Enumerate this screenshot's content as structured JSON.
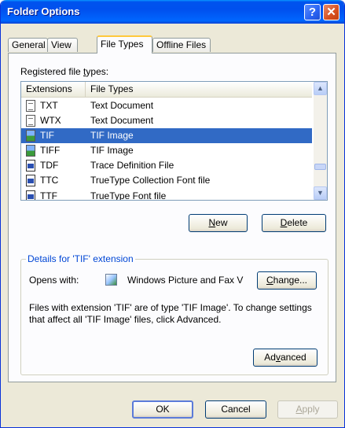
{
  "window": {
    "title": "Folder Options",
    "help_glyph": "?",
    "close_glyph": "✕"
  },
  "tabs": [
    {
      "label": "General",
      "active": false
    },
    {
      "label": "View",
      "active": false
    },
    {
      "label": "File Types",
      "active": true
    },
    {
      "label": "Offline Files",
      "active": false
    }
  ],
  "registered": {
    "label_pre": "Registered file ",
    "label_key": "t",
    "label_post": "ypes:"
  },
  "list": {
    "columns": [
      "Extensions",
      "File Types"
    ],
    "rows": [
      {
        "ext": "TXT",
        "type": "Text Document",
        "icon": "text-document-icon",
        "selected": false
      },
      {
        "ext": "WTX",
        "type": "Text Document",
        "icon": "text-document-icon",
        "selected": false
      },
      {
        "ext": "TIF",
        "type": "TIF Image",
        "icon": "image-file-icon",
        "selected": true
      },
      {
        "ext": "TIFF",
        "type": "TIF Image",
        "icon": "image-file-icon",
        "selected": false
      },
      {
        "ext": "TDF",
        "type": "Trace Definition File",
        "icon": "font-file-icon",
        "selected": false
      },
      {
        "ext": "TTC",
        "type": "TrueType Collection Font file",
        "icon": "font-file-icon",
        "selected": false
      },
      {
        "ext": "TTF",
        "type": "TrueType Font file",
        "icon": "font-file-icon",
        "selected": false
      }
    ],
    "scroll_up_glyph": "▲",
    "scroll_down_glyph": "▼"
  },
  "buttons": {
    "new_key": "N",
    "new_rest": "ew",
    "delete_key": "D",
    "delete_rest": "elete",
    "change_key": "C",
    "change_rest": "hange...",
    "advanced_pre": "Ad",
    "advanced_key": "v",
    "advanced_post": "anced",
    "ok": "OK",
    "cancel": "Cancel",
    "apply_key": "A",
    "apply_rest": "pply"
  },
  "details": {
    "group_title": "Details for 'TIF' extension",
    "opens_with_label": "Opens with:",
    "opens_with_value": "Windows Picture and Fax V",
    "description": "Files with extension 'TIF' are of type 'TIF Image'.  To change settings that affect all 'TIF Image' files, click Advanced."
  },
  "colors": {
    "selection": "#316ac5",
    "title_bar": "#0053ee",
    "group_title": "#0046d5"
  }
}
